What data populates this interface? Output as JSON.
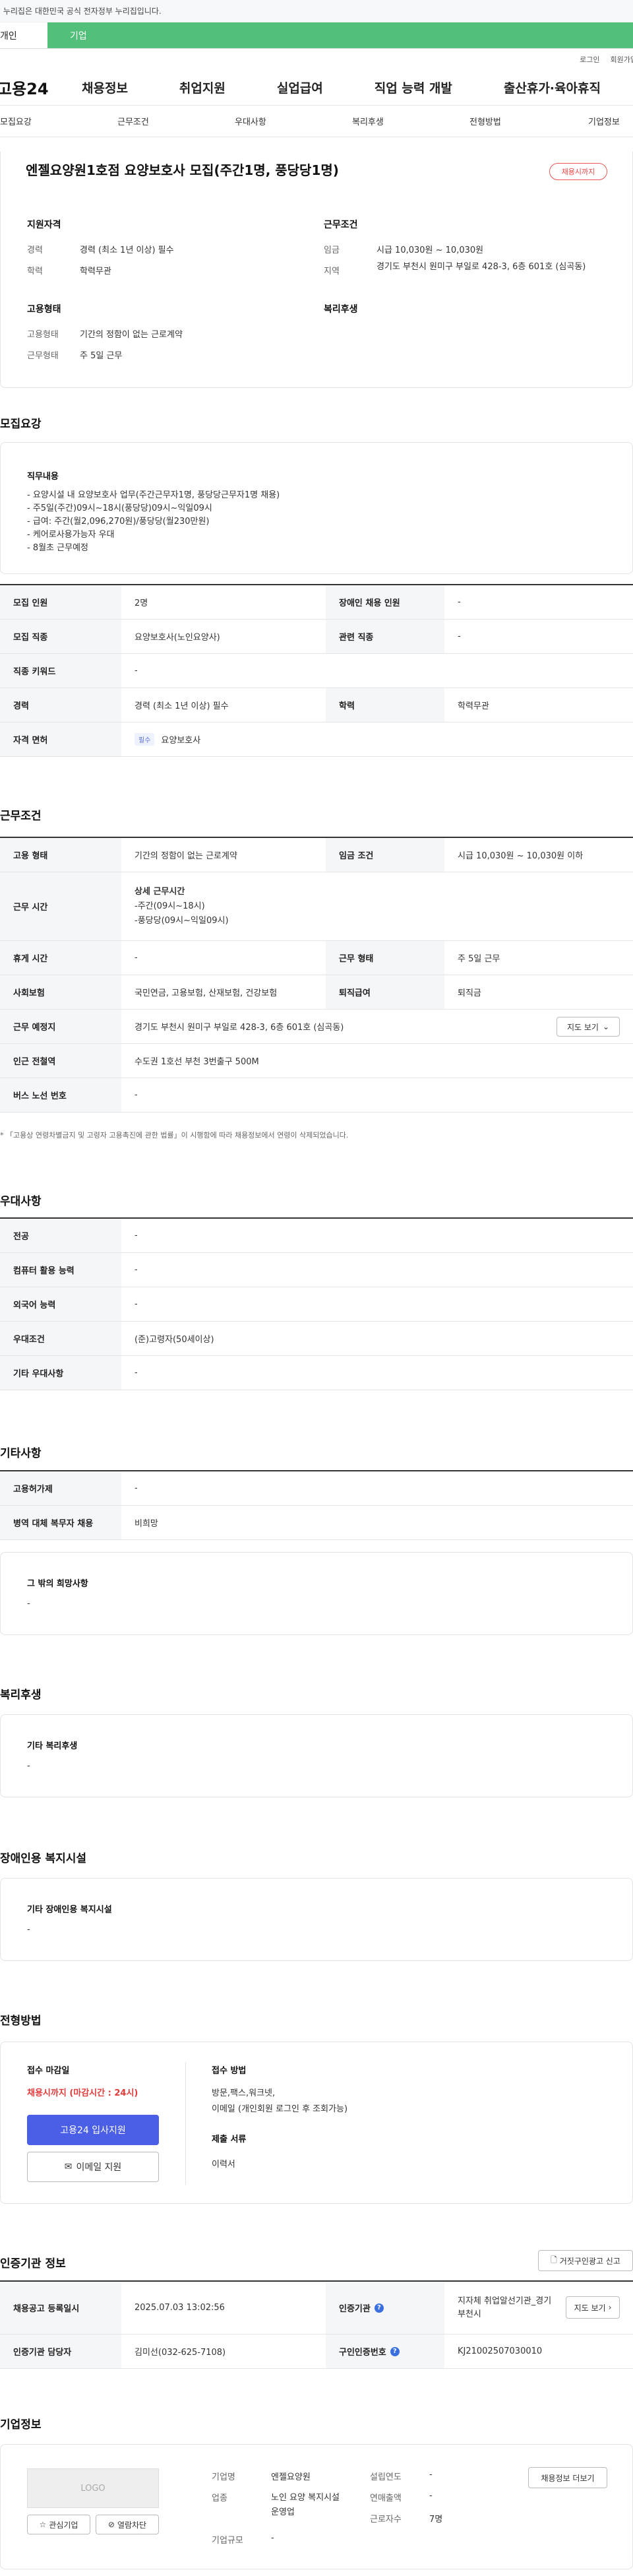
{
  "gov_banner": "이 누리집은 대한민국 공식 전자정부 누리집입니다.",
  "tabs": {
    "personal": "개인",
    "company": "기업"
  },
  "util": {
    "login": "로그인",
    "join": "회원가입"
  },
  "gnb": {
    "logo": "고용24",
    "menu": [
      "채용정보",
      "취업지원",
      "실업급여",
      "직업 능력 개발",
      "출산휴가·육아휴직"
    ]
  },
  "anchor": [
    "모집요강",
    "근무조건",
    "우대사항",
    "복리후생",
    "전형방법",
    "기업정보"
  ],
  "summary": {
    "title": "엔젤요양원1호점 요양보호사 모집(주간1명, 풍당당1명)",
    "status": "채용시까지",
    "qual_title": "지원자격",
    "career_label": "경력",
    "career": "경력 (최소 1년 이상) 필수",
    "edu_label": "학력",
    "edu": "학력무관",
    "cond_title": "근무조건",
    "wage_label": "임금",
    "wage": "시급 10,030원 ~ 10,030원",
    "area_label": "지역",
    "area": "경기도 부천시 원미구 부일로 428-3, 6층 601호 (심곡동)",
    "emp_title": "고용형태",
    "emp_label": "고용형태",
    "emp": "기간의 정함이 없는 근로계약",
    "work_label": "근무형태",
    "work": "주 5일 근무",
    "welfare_title": "복리후생"
  },
  "recruit": {
    "heading": "모집요강",
    "duty_title": "직무내용",
    "duty": [
      "- 요양시설 내 요양보호사 업무(주간근무자1명, 풍당당근무자1명 채용)",
      "- 주5일(주간)09시~18시(풍당당)09시~익일09시",
      "- 급여: 주간(월2,096,270원)/풍당당(월230만원)",
      "- 케어로사용가능자 우대",
      "- 8월초 근무예정"
    ],
    "rows": {
      "count_l": "모집 인원",
      "count": "2명",
      "dis_l": "장애인 채용 인원",
      "dis": "-",
      "job_l": "모집 직종",
      "job": "요양보호사(노인요양사)",
      "rel_l": "관련 직종",
      "rel": "-",
      "kw_l": "직종 키워드",
      "kw": "-",
      "career_l": "경력",
      "career": "경력 (최소 1년 이상) 필수",
      "edu_l": "학력",
      "edu": "학력무관",
      "lic_l": "자격 면허",
      "lic_badge": "필수",
      "lic": "요양보호사"
    }
  },
  "condition": {
    "heading": "근무조건",
    "type_l": "고용 형태",
    "type": "기간의 정함이 없는 근로계약",
    "wage_l": "임금 조건",
    "wage": "시급 10,030원 ~ 10,030원 이하",
    "time_l": "근무 시간",
    "time_title": "상세 근무시간",
    "time1": "-주간(09시~18시)",
    "time2": "-풍당당(09시~익일09시)",
    "rest_l": "휴게 시간",
    "rest": "-",
    "form_l": "근무 형태",
    "form": "주 5일 근무",
    "ins_l": "사회보험",
    "ins": "국민연금, 고용보험, 산재보험, 건강보험",
    "sev_l": "퇴직급여",
    "sev": "퇴직금",
    "loc_l": "근무 예정지",
    "loc": "경기도 부천시 원미구 부일로 428-3, 6층 601호 (심곡동)",
    "map_btn": "지도 보기",
    "subway_l": "인근 전철역",
    "subway": "수도권 1호선 부천 3번출구 500M",
    "bus_l": "버스 노선 번호",
    "bus": "-",
    "note": "* 「고용상 연령차별금지 및 고령자 고용촉진에 관한 법률」이 시행함에 따라 채용정보에서 연령이 삭제되었습니다."
  },
  "pref": {
    "heading": "우대사항",
    "major_l": "전공",
    "major": "-",
    "pc_l": "컴퓨터 활용 능력",
    "pc": "-",
    "lang_l": "외국어 능력",
    "lang": "-",
    "cond_l": "우대조건",
    "cond": "(준)고령자(50세이상)",
    "etc_l": "기타 우대사항",
    "etc": "-"
  },
  "other": {
    "heading": "기타사항",
    "emp_l": "고용허가제",
    "emp": "-",
    "mil_l": "병역 대체 복무자 채용",
    "mil": "비희망",
    "wish_title": "그 밖의 희망사항",
    "wish": "-"
  },
  "welfare": {
    "heading": "복리후생",
    "title": "기타 복리후생",
    "val": "-"
  },
  "disab": {
    "heading": "장애인용 복지시설",
    "title": "기타 장애인용 복지시설",
    "val": "-"
  },
  "selection": {
    "heading": "전형방법",
    "deadline_title": "접수 마감일",
    "deadline": "채용시까지 (마감시간 : 24시)",
    "apply_btn": "고용24 입사지원",
    "email_btn": "이메일 지원",
    "method_title": "접수 방법",
    "method1": "방문,팩스,워크넷,",
    "method2": "이메일 (개인회원 로그인 후 조회가능)",
    "docs_title": "제출 서류",
    "docs": "이력서"
  },
  "agency": {
    "heading": "인증기관 정보",
    "report_btn": "거짓구인광고 신고",
    "reg_l": "채용공고 등록일시",
    "reg": "2025.07.03 13:02:56",
    "org_l": "인증기관",
    "org": "지자체 취업알선기관_경기 부천시",
    "map_btn": "지도 보기",
    "mgr_l": "인증기관 담당자",
    "mgr": "김미선(032-625-7108)",
    "no_l": "구인인증번호",
    "no": "KJ21002507030010"
  },
  "company": {
    "heading": "기업정보",
    "logo": "LOGO",
    "interest_btn": "관심기업",
    "block_btn": "열람차단",
    "name_l": "기업명",
    "name": "엔젤요양원",
    "ind_l": "업종",
    "ind": "노인 요양 복지시설 운영업",
    "size_l": "기업규모",
    "size": "-",
    "year_l": "설립연도",
    "year": "-",
    "sales_l": "연매출액",
    "sales": "-",
    "staff_l": "근로자수",
    "staff": "7명",
    "more_btn": "채용정보 더보기"
  }
}
